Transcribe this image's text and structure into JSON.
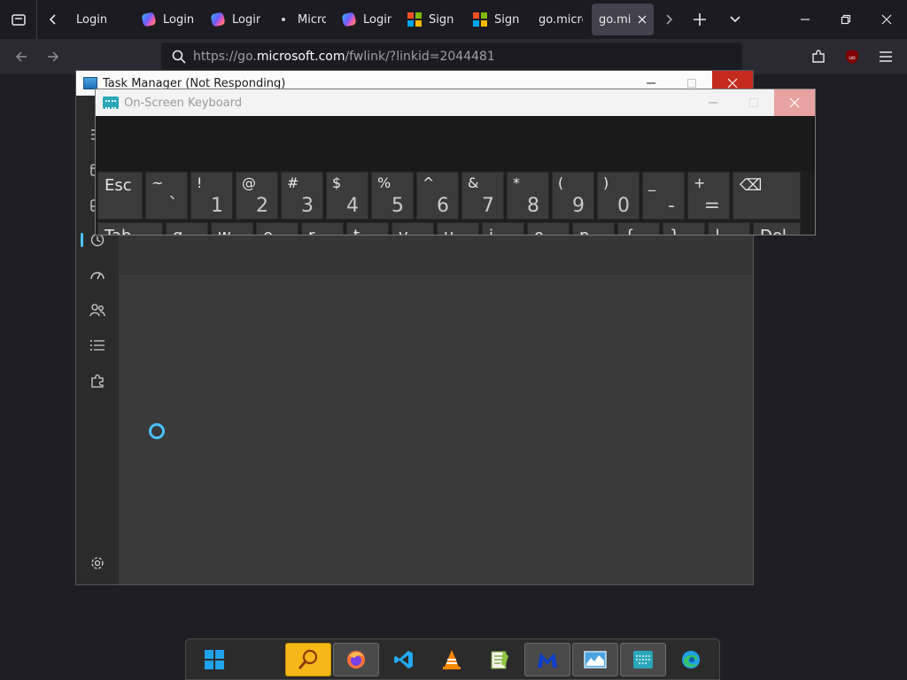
{
  "browser": {
    "tabs": [
      {
        "label": "Login",
        "favicon": "none"
      },
      {
        "label": "Login",
        "favicon": "copilot-icon"
      },
      {
        "label": "Login",
        "favicon": "copilot-icon"
      },
      {
        "label": "Micros",
        "favicon": "dot-icon"
      },
      {
        "label": "Login",
        "favicon": "copilot-icon"
      },
      {
        "label": "Sign ir",
        "favicon": "microsoft-icon"
      },
      {
        "label": "Sign ir",
        "favicon": "microsoft-icon"
      },
      {
        "label": "go.microsi",
        "favicon": "none"
      },
      {
        "label": "go.micr",
        "favicon": "none",
        "active": true
      }
    ],
    "url_prefix": "https://go.",
    "url_domain": "microsoft.com",
    "url_suffix": "/fwlink/?linkid=2044481"
  },
  "task_manager": {
    "title": "Task Manager (Not Responding)"
  },
  "osk": {
    "title": "On-Screen Keyboard",
    "row1": [
      {
        "single": "Esc"
      },
      {
        "up": "~",
        "dn": "`"
      },
      {
        "up": "!",
        "dn": "1"
      },
      {
        "up": "@",
        "dn": "2"
      },
      {
        "up": "#",
        "dn": "3"
      },
      {
        "up": "$",
        "dn": "4"
      },
      {
        "up": "%",
        "dn": "5"
      },
      {
        "up": "^",
        "dn": "6"
      },
      {
        "up": "&",
        "dn": "7"
      },
      {
        "up": "*",
        "dn": "8"
      },
      {
        "up": "(",
        "dn": "9"
      },
      {
        "up": ")",
        "dn": "0"
      },
      {
        "up": "_",
        "dn": "-"
      },
      {
        "up": "+",
        "dn": "="
      },
      {
        "single": "⌫"
      }
    ],
    "row2": [
      {
        "single": "Tab"
      },
      {
        "single": "q"
      },
      {
        "single": "w"
      },
      {
        "single": "e"
      },
      {
        "single": "r"
      },
      {
        "single": "t"
      },
      {
        "single": "y"
      },
      {
        "single": "u"
      },
      {
        "single": "i"
      },
      {
        "single": "o"
      },
      {
        "single": "p"
      },
      {
        "single": "{"
      },
      {
        "single": "}"
      },
      {
        "single": "|"
      },
      {
        "single": "Del"
      }
    ]
  },
  "taskbar": {
    "items": [
      "windows-start-icon",
      "search-app-icon",
      "firefox-icon",
      "vscode-icon",
      "vlc-icon",
      "notepadpp-icon",
      "malwarebytes-icon",
      "task-manager-icon",
      "on-screen-keyboard-icon",
      "edge-icon"
    ]
  },
  "colors": {
    "accent_blue": "#4cc2ff",
    "close_red": "#c42b1c"
  }
}
